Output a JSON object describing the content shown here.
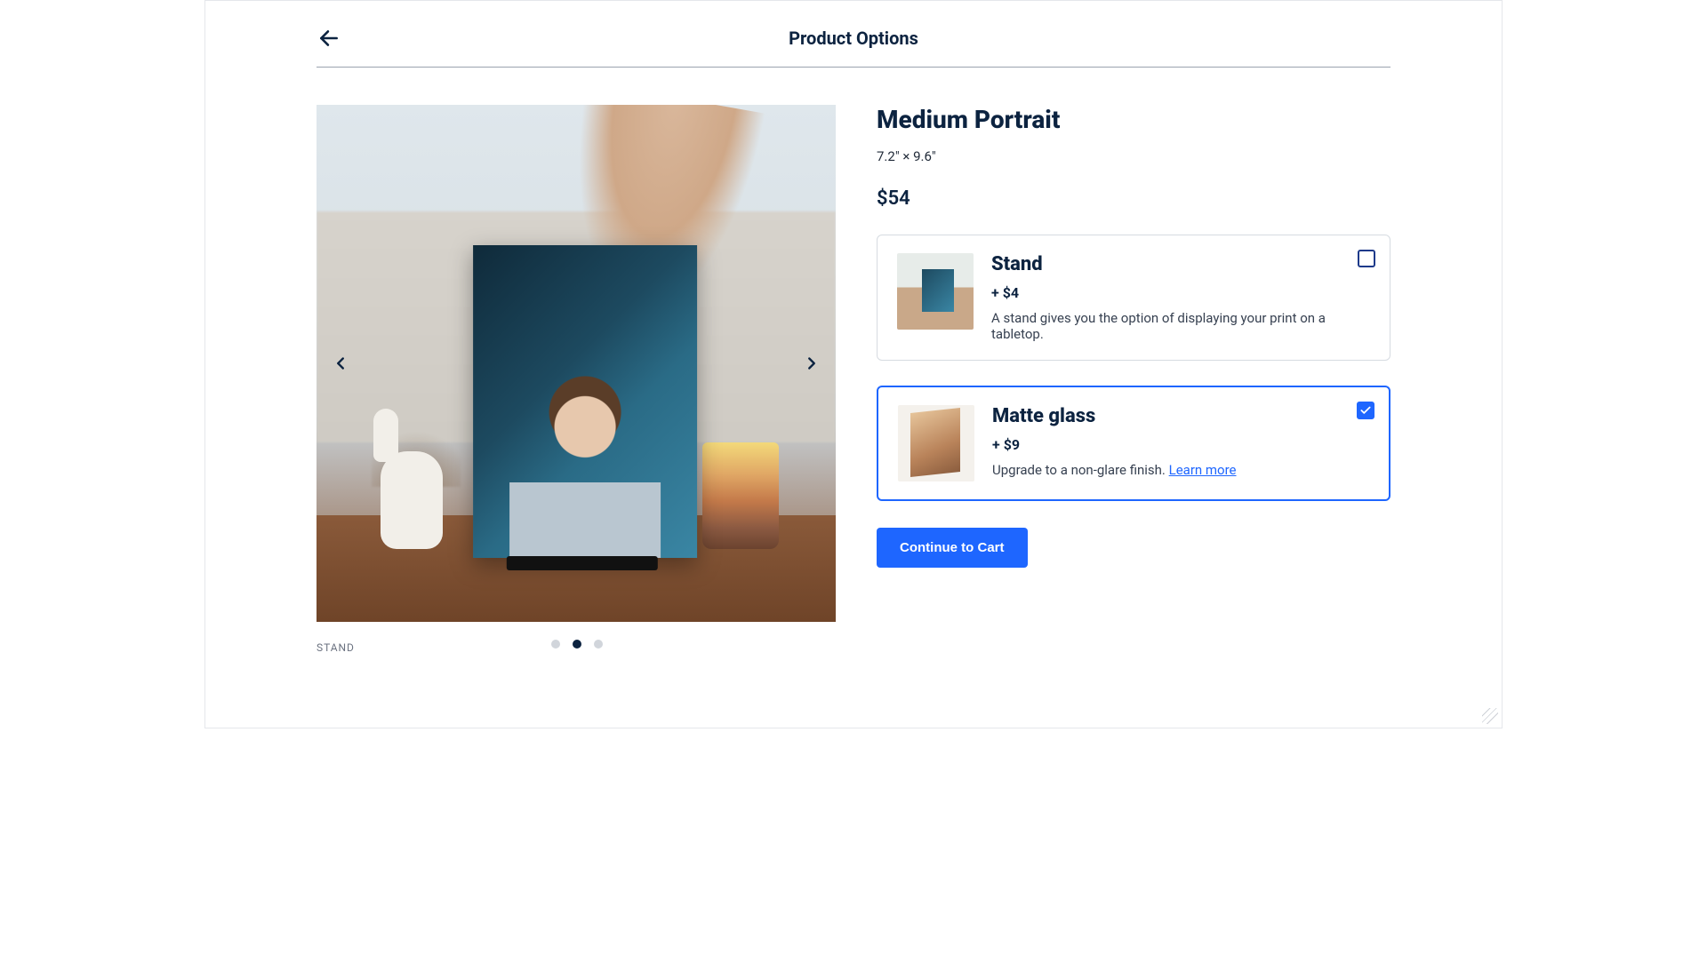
{
  "header": {
    "title": "Product Options",
    "back_icon": "arrow-left-icon"
  },
  "gallery": {
    "caption": "STAND",
    "prev_icon": "chevron-left-icon",
    "next_icon": "chevron-right-icon",
    "dots": {
      "count": 3,
      "active_index": 1
    }
  },
  "product": {
    "name": "Medium Portrait",
    "dimensions": "7.2\" × 9.6\"",
    "price": "$54"
  },
  "options": [
    {
      "id": "stand",
      "title": "Stand",
      "price": "+ $4",
      "description": "A stand gives you the option of displaying your print on a tabletop.",
      "selected": false,
      "learn_more": null
    },
    {
      "id": "matte",
      "title": "Matte glass",
      "price": "+ $9",
      "description": "Upgrade to a non-glare finish. ",
      "selected": true,
      "learn_more": "Learn more"
    }
  ],
  "cta": {
    "label": "Continue to Cart"
  }
}
